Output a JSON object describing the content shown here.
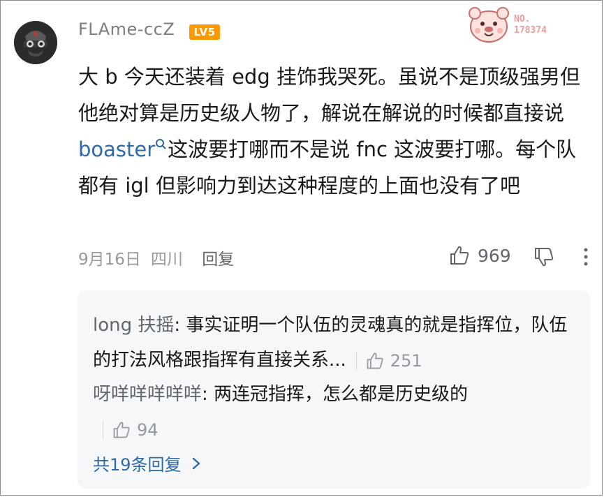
{
  "comment": {
    "username": "FLAme-ccZ",
    "level_badge": "LV5",
    "fan_badge_number": "178374",
    "fan_badge_label": "NO.",
    "text_part1": "大 b 今天还装着 edg 挂饰我哭死。虽说不是顶级强男但他绝对算是历史级人物了，解说在解说的时候都直接说 ",
    "link_text": "boaster",
    "text_part2": "这波要打哪而不是说 fnc 这波要打哪。每个队都有 igl 但影响力到达这种程度的上面也没有了吧",
    "date": "9月16日",
    "location": "四川",
    "reply_label": "回复",
    "like_count": "969"
  },
  "replies": [
    {
      "author": "long 扶摇",
      "text": ": 事实证明一个队伍的灵魂真的就是指挥位，队伍的打法风格跟指挥有直接关系...",
      "likes": "251"
    },
    {
      "author": "呀咩咩咩咩咩",
      "text": ": 两连冠指挥，怎么都是历史级的",
      "likes": "94"
    }
  ],
  "all_replies_label": "共19条回复",
  "colors": {
    "link": "#2b6aa6",
    "level_badge": "#ff9900",
    "reply_background": "#f6f7f8"
  },
  "icons": [
    "search-icon",
    "thumbs-up-icon",
    "thumbs-down-icon",
    "more-vertical-icon",
    "chevron-right-icon"
  ]
}
